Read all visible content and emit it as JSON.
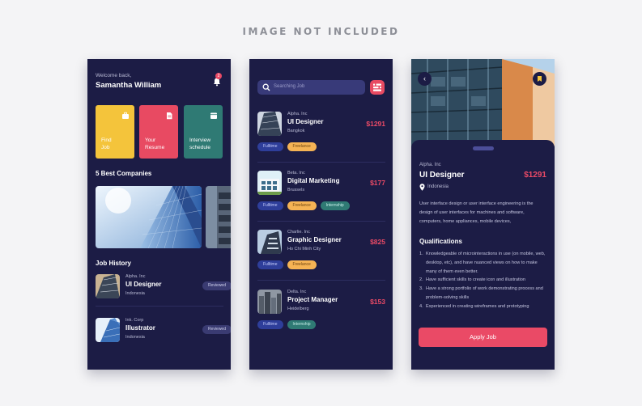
{
  "banner": "IMAGE NOT INCLUDED",
  "colors": {
    "background": "#f4f4f6",
    "screen": "#1c1c45",
    "accent": "#ea4a66",
    "yellow": "#f4c43b",
    "teal": "#2f7a74",
    "blue": "#2e3e9a",
    "orange": "#f5b354"
  },
  "home": {
    "welcome": "Welcome back,",
    "user_name": "Samantha William",
    "notification_count": "2",
    "quick_actions": [
      {
        "label": "Find\nJob",
        "icon": "briefcase-icon"
      },
      {
        "label": "Your\nResume",
        "icon": "document-icon"
      },
      {
        "label": "Interview\nschedule",
        "icon": "calendar-icon"
      }
    ],
    "companies_title": "5 Best Companies",
    "history_title": "Job History",
    "history": [
      {
        "company": "Alpha. Inc",
        "title": "UI Designer",
        "location": "Indonesia",
        "status": "Reviewed"
      },
      {
        "company": "Ink. Corp",
        "title": "Illustrator",
        "location": "Indonesia",
        "status": "Reviewed"
      }
    ]
  },
  "search": {
    "placeholder": "Searching Job",
    "jobs": [
      {
        "company": "Alpha. Inc",
        "title": "UI Designer",
        "location": "Bangkok",
        "salary": "$1291",
        "tags": [
          "Fulltime",
          "Freelance"
        ]
      },
      {
        "company": "Beta. Inc",
        "title": "Digital Marketing",
        "location": "Brussels",
        "salary": "$177",
        "tags": [
          "Fulltime",
          "Freelance",
          "Internship"
        ]
      },
      {
        "company": "Charlie. Inc",
        "title": "Graphic Designer",
        "location": "Ho Chi Minh City",
        "salary": "$825",
        "tags": [
          "Fulltime",
          "Freelance"
        ]
      },
      {
        "company": "Delta. Inc",
        "title": "Project Manager",
        "location": "Heidelberg",
        "salary": "$153",
        "tags": [
          "Fulltime",
          "Internship"
        ]
      }
    ]
  },
  "detail": {
    "company": "Alpha. Inc",
    "title": "UI Designer",
    "salary": "$1291",
    "location": "Indonesia",
    "description": "User interface design or user interface engineering is the design of user interfaces for machines and software, computers, home appliances, mobile devices,",
    "qualifications_title": "Qualifications",
    "qualifications": [
      "Knowledgeable of microinteractions in use (on mobile, web, desktop, etc), and have nuanced views on how to make many of them even better.",
      "Have sufficient skills to create icon and illustration",
      "Have a strong portfolio of work demonstrating process and problem-solving skills",
      "Experienced in creating wireframes and prototyping"
    ],
    "apply_label": "Apply Job"
  }
}
